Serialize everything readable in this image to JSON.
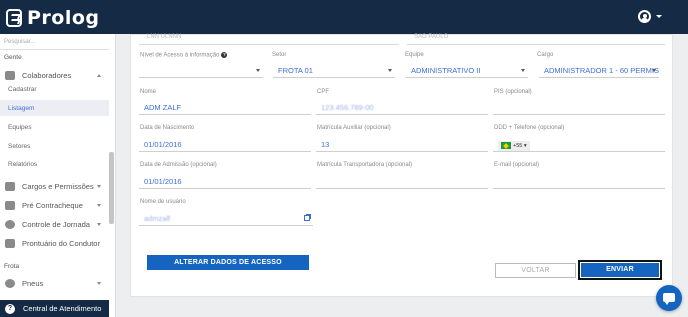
{
  "app": {
    "logo_text": "Prolog"
  },
  "sidebar": {
    "search_placeholder": "Pesquisar...",
    "section_gente": "Gente",
    "section_frota": "Frota",
    "colaboradores": "Colaboradores",
    "cadastrar": "Cadastrar",
    "listagem": "Listagem",
    "equipes": "Equipes",
    "setores": "Setores",
    "relatorios": "Relatórios",
    "cargos": "Cargos e Permissões",
    "pre_contracheque": "Pré Contracheque",
    "controle_jornada": "Controle de Jornada",
    "prontuario": "Prontuário do Condutor",
    "pneus": "Pneus",
    "central": "Central de Atendimento"
  },
  "form": {
    "top_left_value": "LNN ULNNN",
    "top_right_value": "SAO PAULO",
    "nivel_label": "Nível de Acesso à informação",
    "setor_label": "Setor",
    "setor_value": "FROTA 01",
    "equipe_label": "Equipe",
    "equipe_value": "ADMINISTRATIVO II",
    "cargo_label": "Cargo",
    "cargo_value": "ADMINISTRADOR 1 - 60 PERMISSÕES",
    "nome_label": "Nome",
    "nome_value": "ADM ZALF",
    "cpf_label": "CPF",
    "cpf_value": "123.456.789-00",
    "pis_label": "PIS (opcional)",
    "nascimento_label": "Data de Nascimento",
    "nascimento_value": "01/01/2016",
    "matricula_aux_label": "Matrícula Auxiliar (opcional)",
    "matricula_aux_value": "13",
    "ddd_label": "DDD + Telefone (opcional)",
    "ddd_code": "+55",
    "admissao_label": "Data de Admissão (opcional)",
    "admissao_value": "01/01/2016",
    "matricula_transp_label": "Matrícula Transportadora (opcional)",
    "email_label": "E-mail (opcional)",
    "usuario_label": "Nome de usuário",
    "usuario_value": "admzalf",
    "alterar_btn": "ALTERAR DADOS DE ACESSO",
    "voltar_btn": "VOLTAR",
    "enviar_btn": "ENVIAR"
  }
}
